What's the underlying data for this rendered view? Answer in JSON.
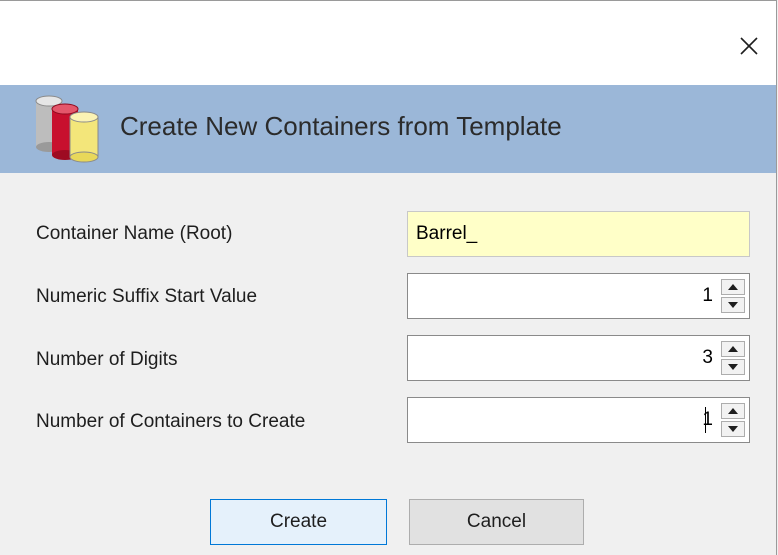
{
  "dialog": {
    "close_icon": "close-icon",
    "banner": {
      "icon": "containers-icon",
      "title": "Create New Containers from Template",
      "color": "#9bb7d8"
    },
    "fields": {
      "root_name": {
        "label": "Container Name (Root)",
        "value": "Barrel_"
      },
      "suffix_start": {
        "label": "Numeric Suffix Start Value",
        "value": "1"
      },
      "digits": {
        "label": "Number of Digits",
        "value": "3"
      },
      "count": {
        "label": "Number of Containers to Create",
        "value": "1"
      }
    },
    "buttons": {
      "create_label": "Create",
      "cancel_label": "Cancel"
    }
  }
}
